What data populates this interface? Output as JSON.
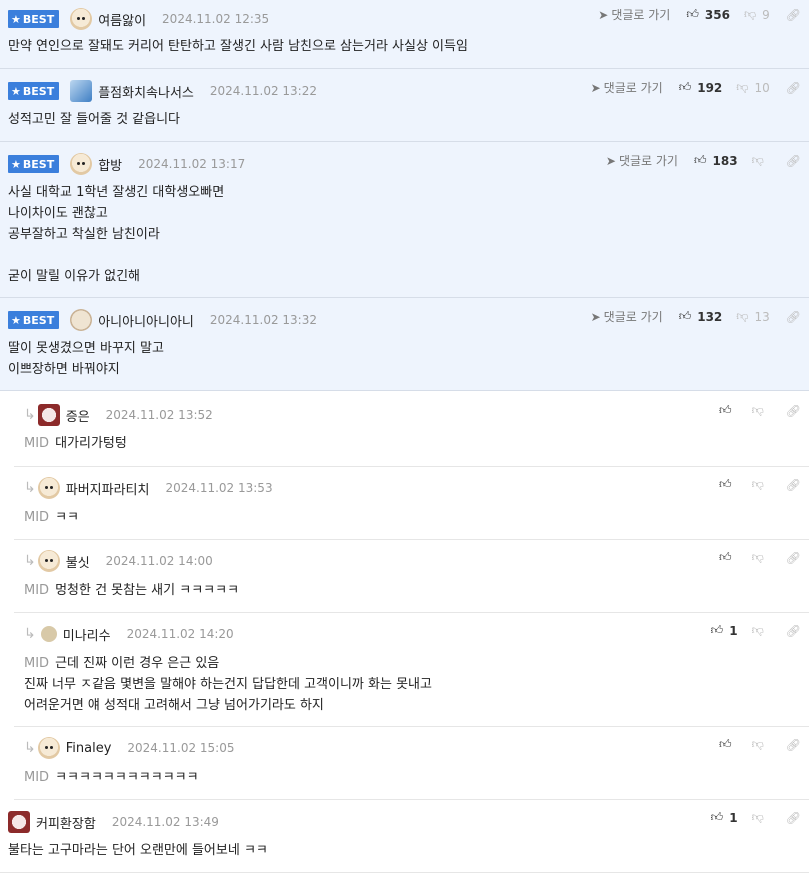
{
  "labels": {
    "best": "BEST",
    "goto": "댓글로 가기",
    "mid": "MID"
  },
  "best_comments": [
    {
      "nick": "여름앓이",
      "date": "2024.11.02 12:35",
      "likes": "356",
      "dislikes": "9",
      "text": "만약 연인으로 잘돼도 커리어 탄탄하고 잘생긴 사람 남친으로 삼는거라 사실상 이득임",
      "avatar": "puppy-avatar"
    },
    {
      "nick": "플점화치속나서스",
      "date": "2024.11.02 13:22",
      "likes": "192",
      "dislikes": "10",
      "text": "성적고민 잘 들어줄 것 같읍니다",
      "avatar": "blue-character-avatar"
    },
    {
      "nick": "합방",
      "date": "2024.11.02 13:17",
      "likes": "183",
      "dislikes": "",
      "text": "사실 대학교 1학년 잘생긴 대학생오빠면\n나이차이도 괜찮고\n공부잘하고 착실한 남친이라\n\n굳이 말릴 이유가 없긴해",
      "avatar": "puppy-avatar"
    },
    {
      "nick": "아니아니아니아니",
      "date": "2024.11.02 13:32",
      "likes": "132",
      "dislikes": "13",
      "text": "딸이 못생겼으면 바꾸지 말고\n이쁘장하면 바꿔야지",
      "avatar": "fluffy-avatar"
    }
  ],
  "replies": [
    {
      "nick": "증은",
      "date": "2024.11.02 13:52",
      "likes": "",
      "text": "대가리가텅텅",
      "avatar": "red-avatar"
    },
    {
      "nick": "파버지파라티치",
      "date": "2024.11.02 13:53",
      "likes": "",
      "text": "ㅋㅋ",
      "avatar": "puppy-avatar"
    },
    {
      "nick": "불싯",
      "date": "2024.11.02 14:00",
      "likes": "",
      "text": "멍청한 건 못참는 새기 ㅋㅋㅋㅋㅋ",
      "avatar": "puppy-avatar"
    },
    {
      "nick": "미나리수",
      "date": "2024.11.02 14:20",
      "likes": "1",
      "text": "근데 진짜 이런 경우 은근 있음\n진짜 너무 ㅈ같음 몇변을 말해야 하는건지 답답한데 고객이니까 화는 못내고\n어려운거면 얘 성적대 고려해서 그냥 넘어가기라도 하지",
      "avatar": "dot-avatar"
    },
    {
      "nick": "Finaley",
      "date": "2024.11.02 15:05",
      "likes": "",
      "text": "ㅋㅋㅋㅋㅋㅋㅋㅋㅋㅋㅋㅋ",
      "avatar": "puppy-avatar"
    }
  ],
  "last_comment": {
    "nick": "커피환장함",
    "date": "2024.11.02 13:49",
    "likes": "1",
    "text": "불타는 고구마라는 단어 오랜만에 들어보네 ㅋㅋ",
    "avatar": "red-avatar"
  },
  "icons": {
    "goto": "navigate-arrow-icon",
    "like": "thumbs-up-icon",
    "dislike": "thumbs-down-icon",
    "link": "link-icon",
    "reply": "reply-arrow-icon",
    "star": "star-icon"
  },
  "colors": {
    "best_bg": "#eef4fd",
    "badge": "#3b7fdc",
    "muted": "#999999"
  }
}
